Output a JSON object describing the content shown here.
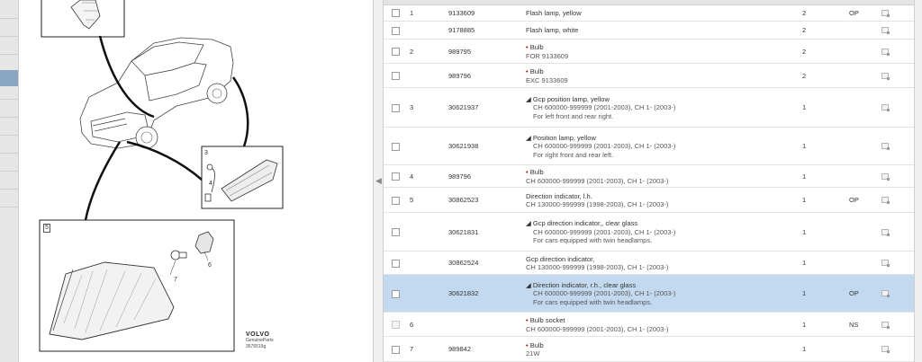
{
  "diagram": {
    "callouts": [
      "3",
      "4",
      "5",
      "6",
      "7"
    ],
    "brand_logo": "VOLVO",
    "brand_sub": "GenuineParts",
    "diagram_number": "3576519g"
  },
  "splitter": {
    "handle": "◀"
  },
  "rows": [
    {
      "pos": "1",
      "part": "9133609",
      "title": "Flash lamp, yellow",
      "title_prefix": "",
      "sub": [],
      "qty": "2",
      "note": "OP",
      "selected": false,
      "checkbox_enabled": true
    },
    {
      "pos": "",
      "part": "9178885",
      "title": "Flash lamp, white",
      "title_prefix": "",
      "sub": [],
      "qty": "2",
      "note": "",
      "selected": false,
      "checkbox_enabled": true
    },
    {
      "pos": "2",
      "part": "989795",
      "title": "Bulb",
      "title_prefix": "•",
      "sub": [
        "FOR 9133609"
      ],
      "qty": "2",
      "note": "",
      "selected": false,
      "checkbox_enabled": true
    },
    {
      "pos": "",
      "part": "989796",
      "title": "Bulb",
      "title_prefix": "•",
      "sub": [
        "EXC 9133609"
      ],
      "qty": "2",
      "note": "",
      "selected": false,
      "checkbox_enabled": true
    },
    {
      "pos": "3",
      "part": "30621937",
      "title": "Gcp position lamp, yellow",
      "title_prefix": "◢",
      "sub": [
        "CH 600000-999999 (2001-2003), CH 1- (2003-)",
        "For left front and rear right."
      ],
      "qty": "1",
      "note": "",
      "selected": false,
      "checkbox_enabled": true
    },
    {
      "pos": "",
      "part": "30621938",
      "title": "Position lamp, yellow",
      "title_prefix": "◢",
      "sub": [
        "CH 600000-999999 (2001-2003), CH 1- (2003-)",
        "For right front and rear left."
      ],
      "qty": "1",
      "note": "",
      "selected": false,
      "checkbox_enabled": true
    },
    {
      "pos": "4",
      "part": "989796",
      "title": "Bulb",
      "title_prefix": "•",
      "sub": [
        "CH 600000-999999 (2001-2003), CH 1- (2003-)"
      ],
      "qty": "1",
      "note": "",
      "selected": false,
      "checkbox_enabled": true
    },
    {
      "pos": "5",
      "part": "30862523",
      "title": "Direction indicator, l.h.",
      "title_prefix": "",
      "sub": [
        "CH 130000-999999 (1998-2003), CH 1- (2003-)"
      ],
      "qty": "1",
      "note": "OP",
      "selected": false,
      "checkbox_enabled": true
    },
    {
      "pos": "",
      "part": "30621831",
      "title": "Gcp direction indicator,, clear glass",
      "title_prefix": "◢",
      "sub": [
        "CH 600000-999999 (2001-2003), CH 1- (2003-)",
        "For cars equipped with twin headlamps."
      ],
      "qty": "1",
      "note": "",
      "selected": false,
      "checkbox_enabled": true
    },
    {
      "pos": "",
      "part": "30862524",
      "title": "Gcp direction indicator,",
      "title_prefix": "",
      "sub": [
        "CH 130000-999999 (1998-2003), CH 1- (2003-)"
      ],
      "qty": "1",
      "note": "",
      "selected": false,
      "checkbox_enabled": true
    },
    {
      "pos": "",
      "part": "30621832",
      "title": "Direction indicator, r.h., clear glass",
      "title_prefix": "◢",
      "sub": [
        "CH 600000-999999 (2001-2003), CH 1- (2003-)",
        "For cars equipped with twin headlamps."
      ],
      "qty": "1",
      "note": "OP",
      "selected": true,
      "checkbox_enabled": true
    },
    {
      "pos": "6",
      "part": "",
      "title": "Bulb socket",
      "title_prefix": "•",
      "sub": [
        "CH 600000-999999 (2001-2003), CH 1- (2003-)"
      ],
      "qty": "1",
      "note": "NS",
      "selected": false,
      "checkbox_enabled": false
    },
    {
      "pos": "7",
      "part": "989842",
      "title": "Bulb",
      "title_prefix": "•",
      "sub": [
        "21W"
      ],
      "qty": "1",
      "note": "",
      "selected": false,
      "checkbox_enabled": true
    }
  ]
}
